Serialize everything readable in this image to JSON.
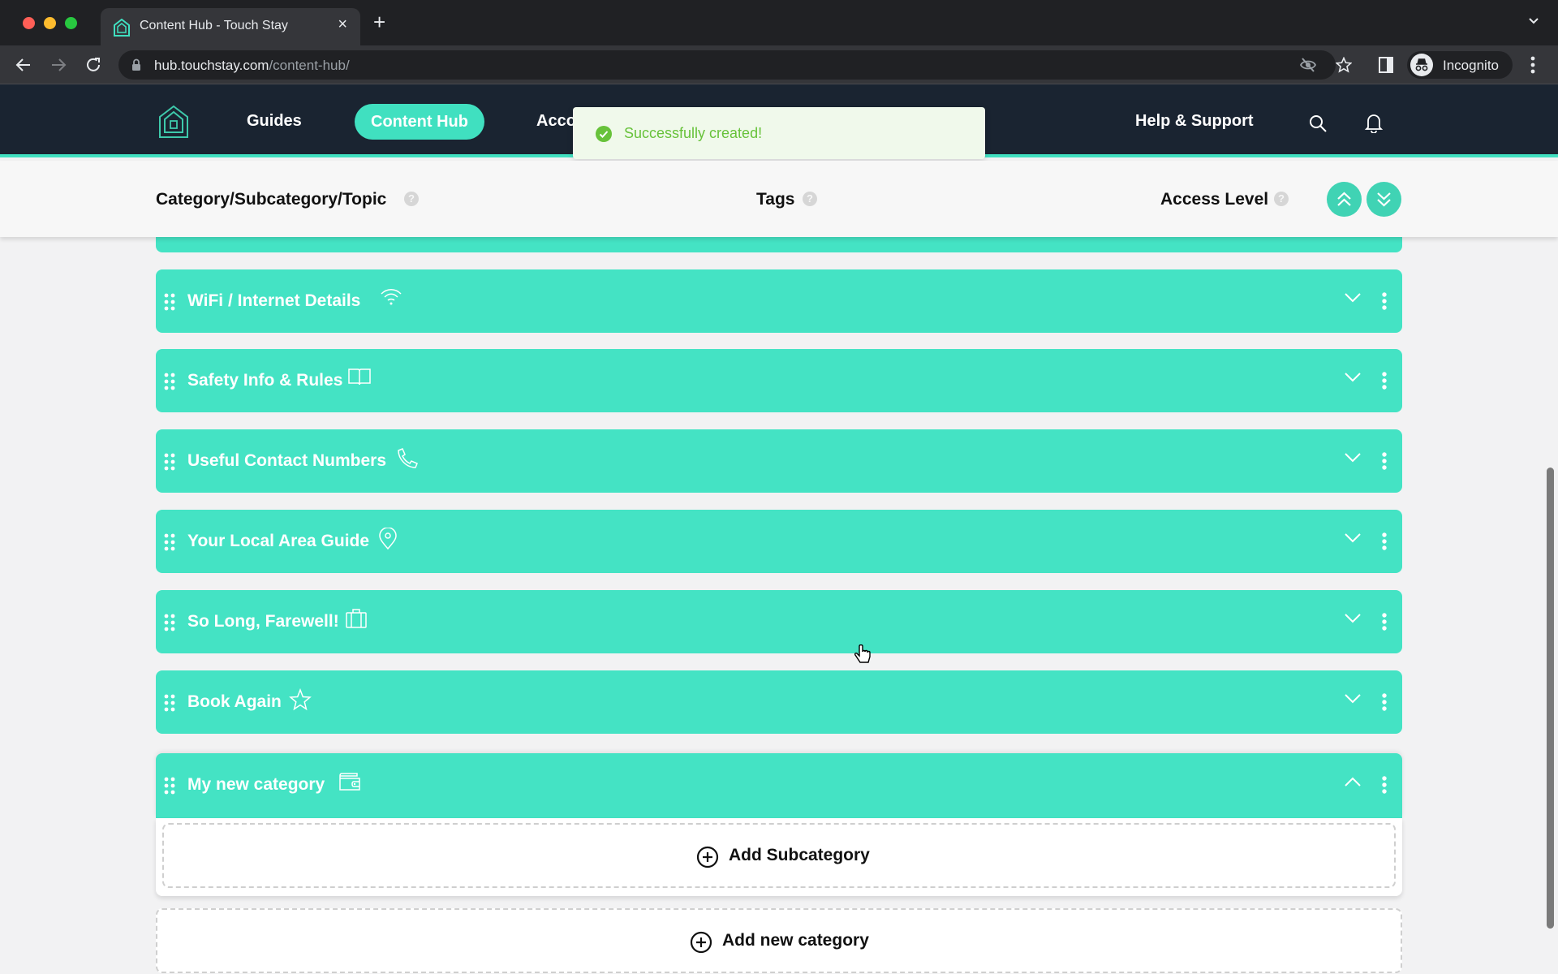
{
  "browser": {
    "tab_title": "Content Hub - Touch Stay",
    "url_host": "hub.touchstay.com",
    "url_path": "/content-hub/",
    "profile_label": "Incognito"
  },
  "nav": {
    "links": [
      {
        "label": "Guides"
      },
      {
        "label": "Content Hub",
        "active": true
      },
      {
        "label": "Account"
      },
      {
        "label": "Help & Support"
      }
    ]
  },
  "toast": {
    "message": "Successfully created!",
    "status": "success"
  },
  "columns": {
    "category": "Category/Subcategory/Topic",
    "tags": "Tags",
    "access": "Access Level",
    "help_glyph": "?"
  },
  "categories": [
    {
      "title": "WiFi / Internet Details",
      "icon": "wifi-icon",
      "expanded": false
    },
    {
      "title": "Safety Info & Rules",
      "icon": "book-icon",
      "expanded": false
    },
    {
      "title": "Useful Contact Numbers",
      "icon": "phone-icon",
      "expanded": false
    },
    {
      "title": "Your Local Area Guide",
      "icon": "map-pin-icon",
      "expanded": false
    },
    {
      "title": "So Long, Farewell!",
      "icon": "suitcase-icon",
      "expanded": false
    },
    {
      "title": "Book Again",
      "icon": "star-icon",
      "expanded": false
    },
    {
      "title": "My new category",
      "icon": "wallet-icon",
      "expanded": true
    }
  ],
  "actions": {
    "add_subcategory": "Add Subcategory",
    "add_category": "Add new category"
  },
  "colors": {
    "accent": "#44e3c4",
    "nav_bg": "#1a2431",
    "toast_bg": "#f0f9eb",
    "toast_text": "#67c23a"
  }
}
